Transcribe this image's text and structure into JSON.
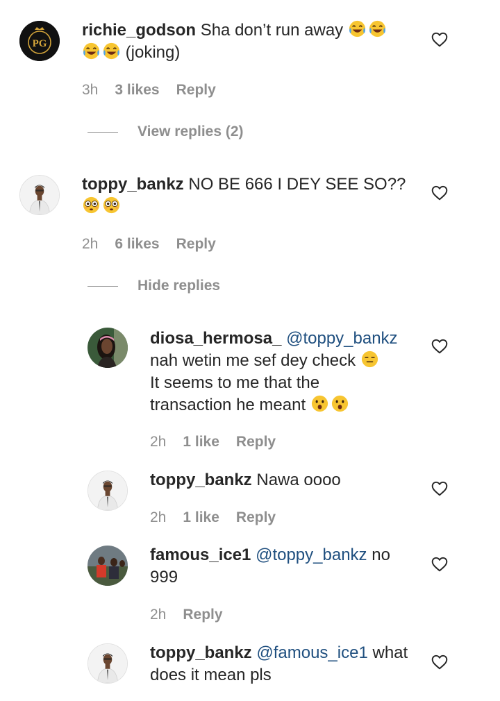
{
  "comments": [
    {
      "username": "richie_godson",
      "text": "Sha don’t run away",
      "suffix": "(joking)",
      "time": "3h",
      "likes": "3 likes",
      "reply": "Reply",
      "avatar_icon": "pg-logo-icon"
    },
    {
      "username": "toppy_bankz",
      "text": "NO BE 666 I DEY SEE SO??",
      "time": "2h",
      "likes": "6 likes",
      "reply": "Reply",
      "avatar_icon": "person-white-shirt-avatar"
    }
  ],
  "view_replies": "View replies (2)",
  "hide_replies": "Hide replies",
  "replies": [
    {
      "username": "diosa_hermosa_",
      "mention": "@toppy_bankz",
      "line1": "nah wetin me sef dey check",
      "line2": "It seems to me that the",
      "line3": "transaction he meant",
      "time": "2h",
      "likes": "1 like",
      "reply": "Reply"
    },
    {
      "username": "toppy_bankz",
      "text": "Nawa oooo",
      "time": "2h",
      "likes": "1 like",
      "reply": "Reply"
    },
    {
      "username": "famous_ice1",
      "mention": "@toppy_bankz",
      "text": "no",
      "line2": "999",
      "time": "2h",
      "reply": "Reply"
    },
    {
      "username": "toppy_bankz",
      "mention": "@famous_ice1",
      "text": "what",
      "line2": "does it mean pls"
    }
  ],
  "colors": {
    "text": "#262626",
    "muted": "#8e8e8e",
    "mention": "#1f4f7f"
  }
}
